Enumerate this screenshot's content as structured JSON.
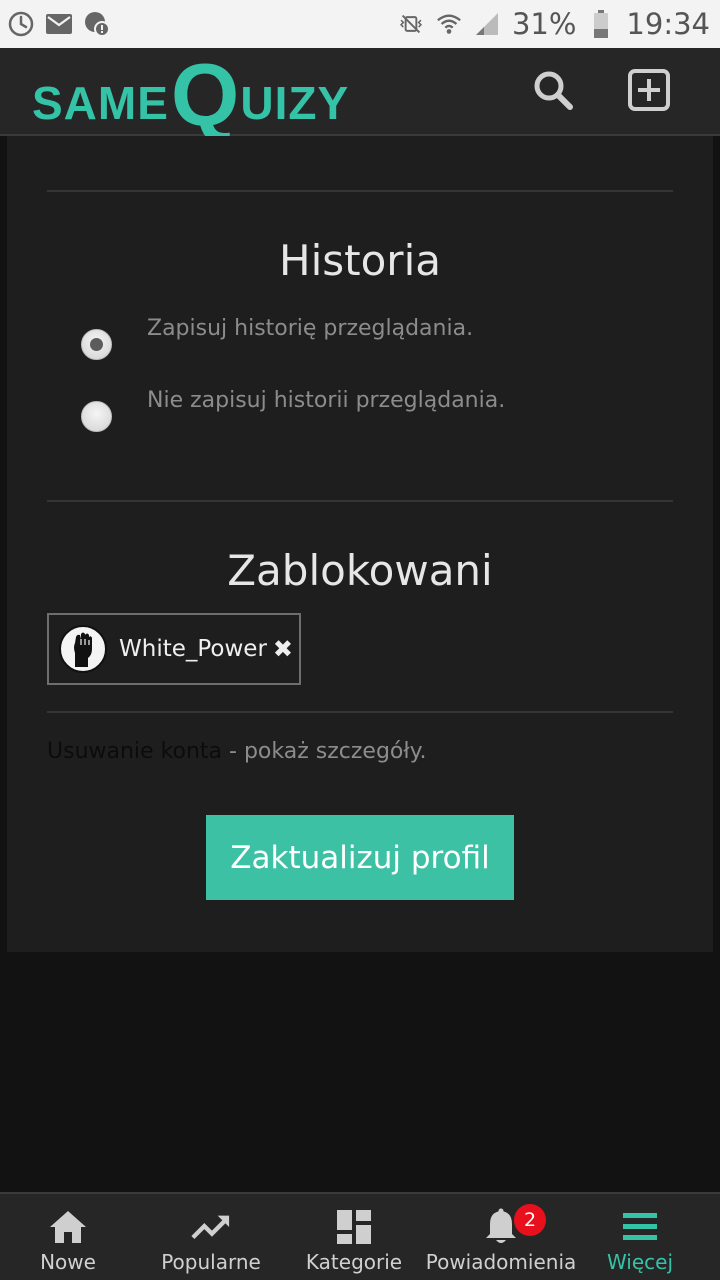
{
  "status_bar": {
    "icons_left": [
      "clock-icon",
      "mail-icon",
      "chat-alert-icon"
    ],
    "icons_right": [
      "vibrate-mute-icon",
      "wifi-icon",
      "signal-icon"
    ],
    "battery": "31%",
    "time": "19:34"
  },
  "header": {
    "logo": {
      "part1": "SAME",
      "part2": "Q",
      "part3": "UIZY"
    },
    "search_icon": "search-icon",
    "add_icon": "add-square-icon",
    "accent_color": "#35c3a7"
  },
  "history": {
    "title": "Historia",
    "options": [
      {
        "label": "Zapisuj historię przeglądania.",
        "checked": true
      },
      {
        "label": "Nie zapisuj historii przeglądania.",
        "checked": false
      }
    ]
  },
  "blocked": {
    "title": "Zablokowani",
    "users": [
      {
        "name": "White_Power",
        "remove": "✖",
        "avatar_icon": "raised-fist-icon"
      }
    ]
  },
  "account_delete": {
    "link": "Usuwanie konta",
    "rest": " - pokaż szczegóły."
  },
  "update_button": {
    "label": "Zaktualizuj profil",
    "color": "#3dc1a5"
  },
  "bottom_nav": {
    "items": [
      {
        "label": "Nowe",
        "icon": "home-icon",
        "active": false
      },
      {
        "label": "Popularne",
        "icon": "trending-icon",
        "active": false
      },
      {
        "label": "Kategorie",
        "icon": "dashboard-icon",
        "active": false
      },
      {
        "label": "Powiadomienia",
        "icon": "bell-icon",
        "active": false,
        "badge": "2"
      },
      {
        "label": "Więcej",
        "icon": "menu-icon",
        "active": true
      }
    ]
  }
}
